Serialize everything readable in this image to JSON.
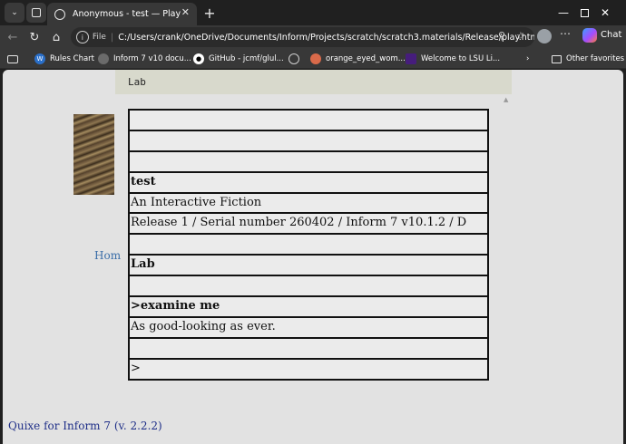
{
  "browser": {
    "tab_title": "Anonymous - test — Play",
    "address": {
      "scheme": "File",
      "url": "C:/Users/crank/OneDrive/Documents/Inform/Projects/scratch/scratch3.materials/Release/play.html"
    },
    "chat_label": "Chat",
    "bookmarks": [
      {
        "label": "Rules Chart",
        "icon": "wordpress-icon",
        "color": "#2a6fc9"
      },
      {
        "label": "Inform 7 v10 docu...",
        "icon": "site-icon",
        "color": "#6b6b6b"
      },
      {
        "label": "GitHub - jcmf/glul...",
        "icon": "github-icon",
        "color": "#ffffff"
      },
      {
        "label": "",
        "icon": "globe-icon",
        "color": "#cfcfcf"
      },
      {
        "label": "orange_eyed_wom...",
        "icon": "site-icon",
        "color": "#d96a4a"
      },
      {
        "label": "Welcome to LSU Li...",
        "icon": "lsu-icon",
        "color": "#461d7c"
      }
    ],
    "other_favorites": "Other favorites"
  },
  "game": {
    "location": "Lab",
    "home_link": "Hom",
    "footer": "Quixe for Inform 7 (v. 2.2.2)",
    "transcript": [
      {
        "text": "",
        "style": "normal"
      },
      {
        "text": "",
        "style": "normal"
      },
      {
        "text": "",
        "style": "normal"
      },
      {
        "text": "test",
        "style": "bold"
      },
      {
        "text": "An Interactive Fiction",
        "style": "normal"
      },
      {
        "text": "Release 1 / Serial number 260402 / Inform 7 v10.1.2 / D",
        "style": "normal"
      },
      {
        "text": "",
        "style": "normal"
      },
      {
        "text": "Lab",
        "style": "bold"
      },
      {
        "text": "",
        "style": "normal"
      },
      {
        "text": ">examine me",
        "style": "bold"
      },
      {
        "text": "As good-looking as ever.",
        "style": "normal"
      },
      {
        "text": "",
        "style": "normal"
      },
      {
        "text": ">",
        "style": "normal"
      }
    ]
  }
}
